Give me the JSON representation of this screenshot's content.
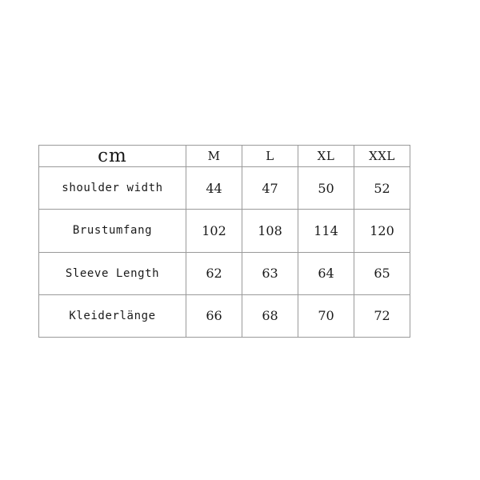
{
  "chart_data": {
    "type": "table",
    "title": "",
    "unit_label": "cm",
    "columns": [
      "cm",
      "M",
      "L",
      "XL",
      "XXL"
    ],
    "size_columns": [
      "M",
      "L",
      "XL",
      "XXL"
    ],
    "row_labels": [
      "shoulder width",
      "Brustumfang",
      "Sleeve Length",
      "Kleiderlänge"
    ],
    "rows": [
      {
        "label": "shoulder width",
        "values": [
          "44",
          "47",
          "50",
          "52"
        ]
      },
      {
        "label": "Brustumfang",
        "values": [
          "102",
          "108",
          "114",
          "120"
        ]
      },
      {
        "label": "Sleeve Length",
        "values": [
          "62",
          "63",
          "64",
          "65"
        ]
      },
      {
        "label": "Kleiderlänge",
        "values": [
          "66",
          "68",
          "70",
          "72"
        ]
      }
    ],
    "series": [
      {
        "name": "M",
        "values": [
          44,
          102,
          62,
          66
        ]
      },
      {
        "name": "L",
        "values": [
          47,
          108,
          63,
          68
        ]
      },
      {
        "name": "XL",
        "values": [
          50,
          114,
          64,
          70
        ]
      },
      {
        "name": "XXL",
        "values": [
          52,
          120,
          65,
          72
        ]
      }
    ],
    "categories": [
      "shoulder width",
      "Brustumfang",
      "Sleeve Length",
      "Kleiderlänge"
    ],
    "grid": true,
    "legend_position": "none"
  },
  "colors": {
    "background": "#ffffff",
    "border": "#9a9a9a",
    "text": "#111111",
    "value_text": "#1b1b1b"
  }
}
